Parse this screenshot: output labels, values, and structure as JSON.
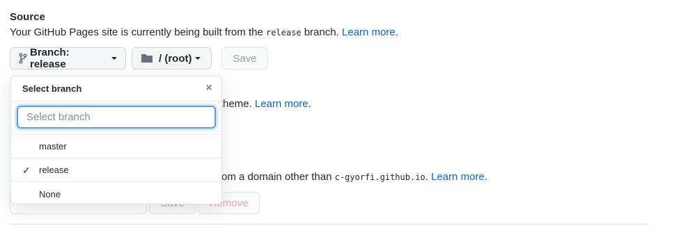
{
  "source": {
    "heading": "Source",
    "desc_prefix": "Your GitHub Pages site is currently being built from the ",
    "branch_code": "release",
    "desc_suffix": " branch. ",
    "learn_more": "Learn more",
    "period": "."
  },
  "toolbar": {
    "branch_label": "Branch: release",
    "folder_label": "/ (root)",
    "save_label": "Save"
  },
  "theme": {
    "text_partial": "ll theme. ",
    "learn_more": "Learn more",
    "period": "."
  },
  "custom_domain": {
    "text_partial": "rom a domain other than ",
    "domain_code": "c-gyorfi.github.io",
    "text_after": ". ",
    "learn_more": "Learn more",
    "period": ".",
    "save_label": "Save",
    "remove_label": "Remove"
  },
  "dropdown": {
    "title": "Select branch",
    "filter_placeholder": "Select branch",
    "items": [
      {
        "label": "master",
        "selected": false
      },
      {
        "label": "release",
        "selected": true
      },
      {
        "label": "None",
        "selected": false
      }
    ]
  }
}
